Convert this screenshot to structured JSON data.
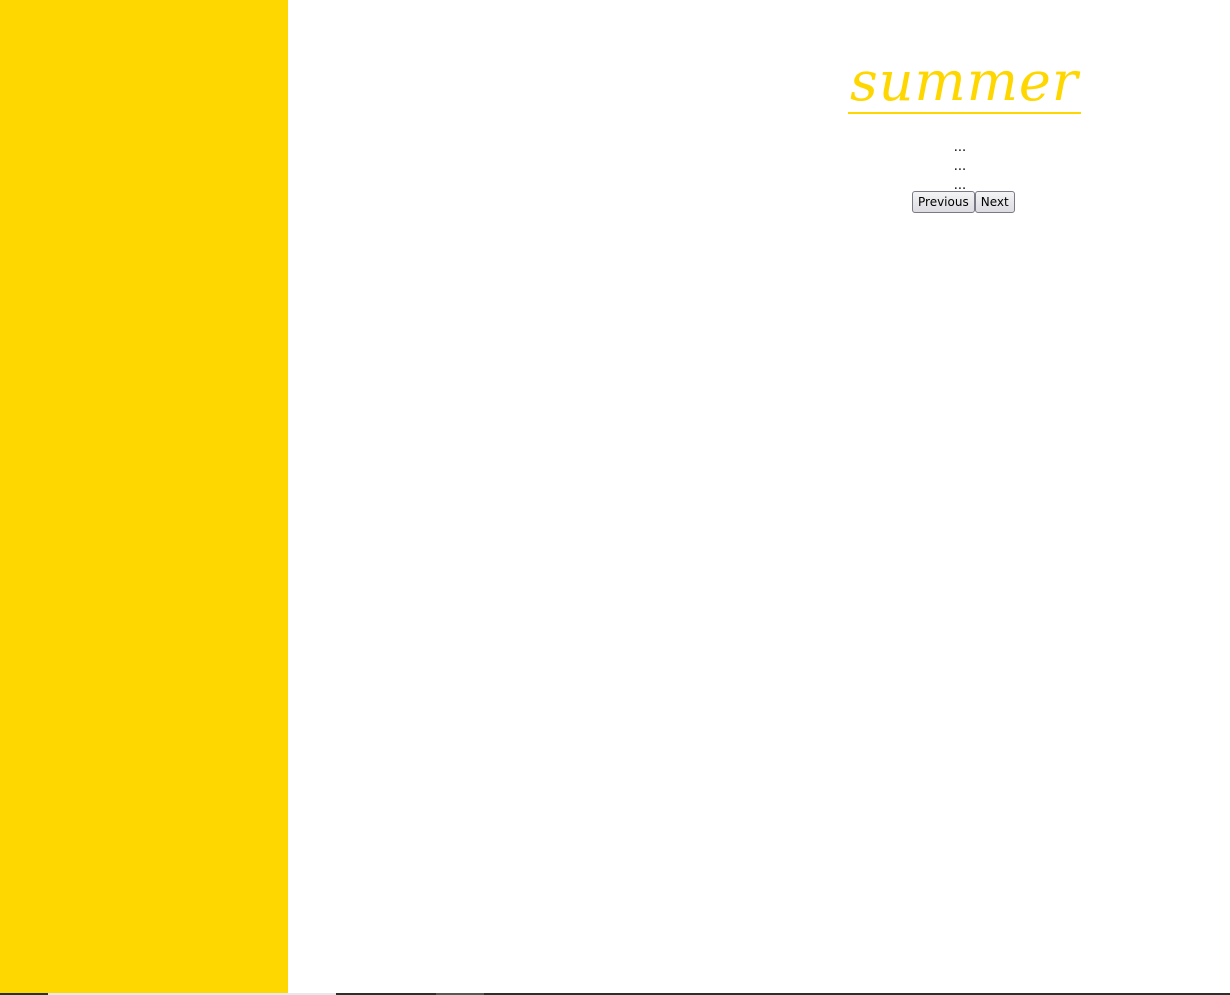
{
  "colors": {
    "accent": "#FFD700",
    "background": "#FFFFFF",
    "text": "#000000"
  },
  "header": {
    "title": "summer"
  },
  "main": {
    "placeholder_lines": [
      "...",
      "...",
      "..."
    ]
  },
  "pagination": {
    "previous_label": "Previous",
    "next_label": "Next"
  }
}
